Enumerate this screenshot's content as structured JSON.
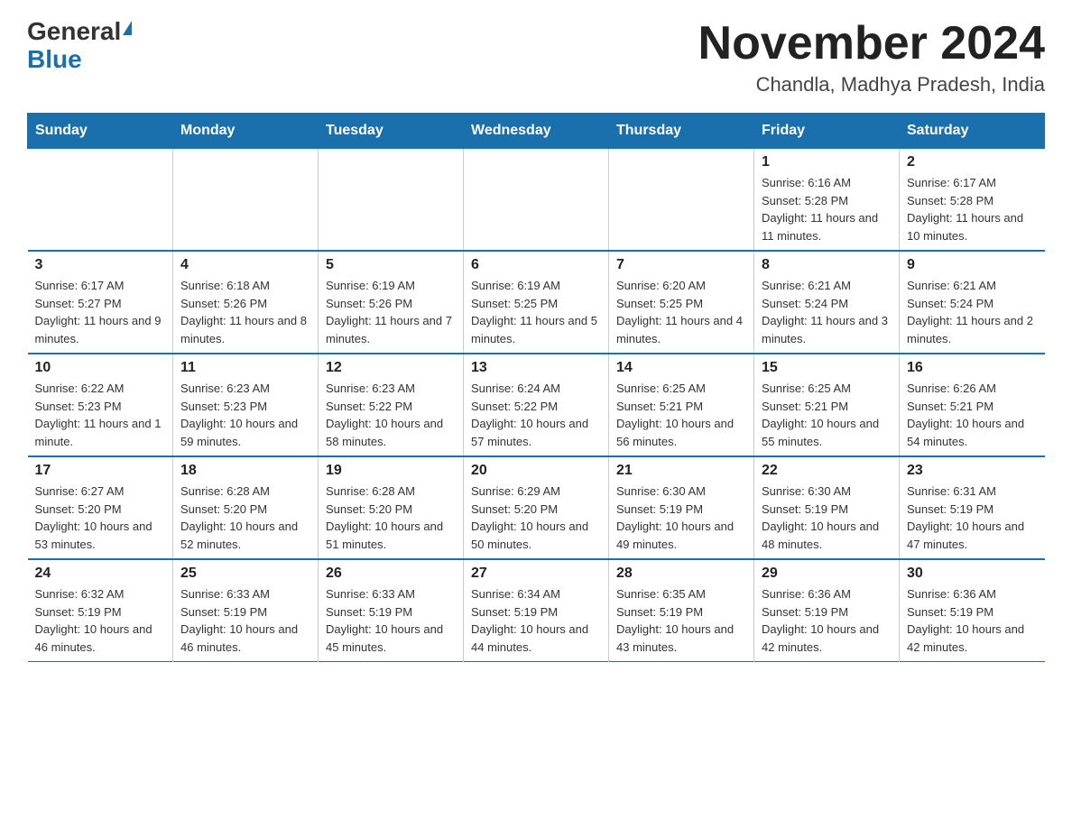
{
  "logo": {
    "general": "General",
    "blue": "Blue"
  },
  "title": "November 2024",
  "location": "Chandla, Madhya Pradesh, India",
  "days_header": [
    "Sunday",
    "Monday",
    "Tuesday",
    "Wednesday",
    "Thursday",
    "Friday",
    "Saturday"
  ],
  "weeks": [
    [
      {
        "day": "",
        "info": ""
      },
      {
        "day": "",
        "info": ""
      },
      {
        "day": "",
        "info": ""
      },
      {
        "day": "",
        "info": ""
      },
      {
        "day": "",
        "info": ""
      },
      {
        "day": "1",
        "info": "Sunrise: 6:16 AM\nSunset: 5:28 PM\nDaylight: 11 hours and 11 minutes."
      },
      {
        "day": "2",
        "info": "Sunrise: 6:17 AM\nSunset: 5:28 PM\nDaylight: 11 hours and 10 minutes."
      }
    ],
    [
      {
        "day": "3",
        "info": "Sunrise: 6:17 AM\nSunset: 5:27 PM\nDaylight: 11 hours and 9 minutes."
      },
      {
        "day": "4",
        "info": "Sunrise: 6:18 AM\nSunset: 5:26 PM\nDaylight: 11 hours and 8 minutes."
      },
      {
        "day": "5",
        "info": "Sunrise: 6:19 AM\nSunset: 5:26 PM\nDaylight: 11 hours and 7 minutes."
      },
      {
        "day": "6",
        "info": "Sunrise: 6:19 AM\nSunset: 5:25 PM\nDaylight: 11 hours and 5 minutes."
      },
      {
        "day": "7",
        "info": "Sunrise: 6:20 AM\nSunset: 5:25 PM\nDaylight: 11 hours and 4 minutes."
      },
      {
        "day": "8",
        "info": "Sunrise: 6:21 AM\nSunset: 5:24 PM\nDaylight: 11 hours and 3 minutes."
      },
      {
        "day": "9",
        "info": "Sunrise: 6:21 AM\nSunset: 5:24 PM\nDaylight: 11 hours and 2 minutes."
      }
    ],
    [
      {
        "day": "10",
        "info": "Sunrise: 6:22 AM\nSunset: 5:23 PM\nDaylight: 11 hours and 1 minute."
      },
      {
        "day": "11",
        "info": "Sunrise: 6:23 AM\nSunset: 5:23 PM\nDaylight: 10 hours and 59 minutes."
      },
      {
        "day": "12",
        "info": "Sunrise: 6:23 AM\nSunset: 5:22 PM\nDaylight: 10 hours and 58 minutes."
      },
      {
        "day": "13",
        "info": "Sunrise: 6:24 AM\nSunset: 5:22 PM\nDaylight: 10 hours and 57 minutes."
      },
      {
        "day": "14",
        "info": "Sunrise: 6:25 AM\nSunset: 5:21 PM\nDaylight: 10 hours and 56 minutes."
      },
      {
        "day": "15",
        "info": "Sunrise: 6:25 AM\nSunset: 5:21 PM\nDaylight: 10 hours and 55 minutes."
      },
      {
        "day": "16",
        "info": "Sunrise: 6:26 AM\nSunset: 5:21 PM\nDaylight: 10 hours and 54 minutes."
      }
    ],
    [
      {
        "day": "17",
        "info": "Sunrise: 6:27 AM\nSunset: 5:20 PM\nDaylight: 10 hours and 53 minutes."
      },
      {
        "day": "18",
        "info": "Sunrise: 6:28 AM\nSunset: 5:20 PM\nDaylight: 10 hours and 52 minutes."
      },
      {
        "day": "19",
        "info": "Sunrise: 6:28 AM\nSunset: 5:20 PM\nDaylight: 10 hours and 51 minutes."
      },
      {
        "day": "20",
        "info": "Sunrise: 6:29 AM\nSunset: 5:20 PM\nDaylight: 10 hours and 50 minutes."
      },
      {
        "day": "21",
        "info": "Sunrise: 6:30 AM\nSunset: 5:19 PM\nDaylight: 10 hours and 49 minutes."
      },
      {
        "day": "22",
        "info": "Sunrise: 6:30 AM\nSunset: 5:19 PM\nDaylight: 10 hours and 48 minutes."
      },
      {
        "day": "23",
        "info": "Sunrise: 6:31 AM\nSunset: 5:19 PM\nDaylight: 10 hours and 47 minutes."
      }
    ],
    [
      {
        "day": "24",
        "info": "Sunrise: 6:32 AM\nSunset: 5:19 PM\nDaylight: 10 hours and 46 minutes."
      },
      {
        "day": "25",
        "info": "Sunrise: 6:33 AM\nSunset: 5:19 PM\nDaylight: 10 hours and 46 minutes."
      },
      {
        "day": "26",
        "info": "Sunrise: 6:33 AM\nSunset: 5:19 PM\nDaylight: 10 hours and 45 minutes."
      },
      {
        "day": "27",
        "info": "Sunrise: 6:34 AM\nSunset: 5:19 PM\nDaylight: 10 hours and 44 minutes."
      },
      {
        "day": "28",
        "info": "Sunrise: 6:35 AM\nSunset: 5:19 PM\nDaylight: 10 hours and 43 minutes."
      },
      {
        "day": "29",
        "info": "Sunrise: 6:36 AM\nSunset: 5:19 PM\nDaylight: 10 hours and 42 minutes."
      },
      {
        "day": "30",
        "info": "Sunrise: 6:36 AM\nSunset: 5:19 PM\nDaylight: 10 hours and 42 minutes."
      }
    ]
  ]
}
